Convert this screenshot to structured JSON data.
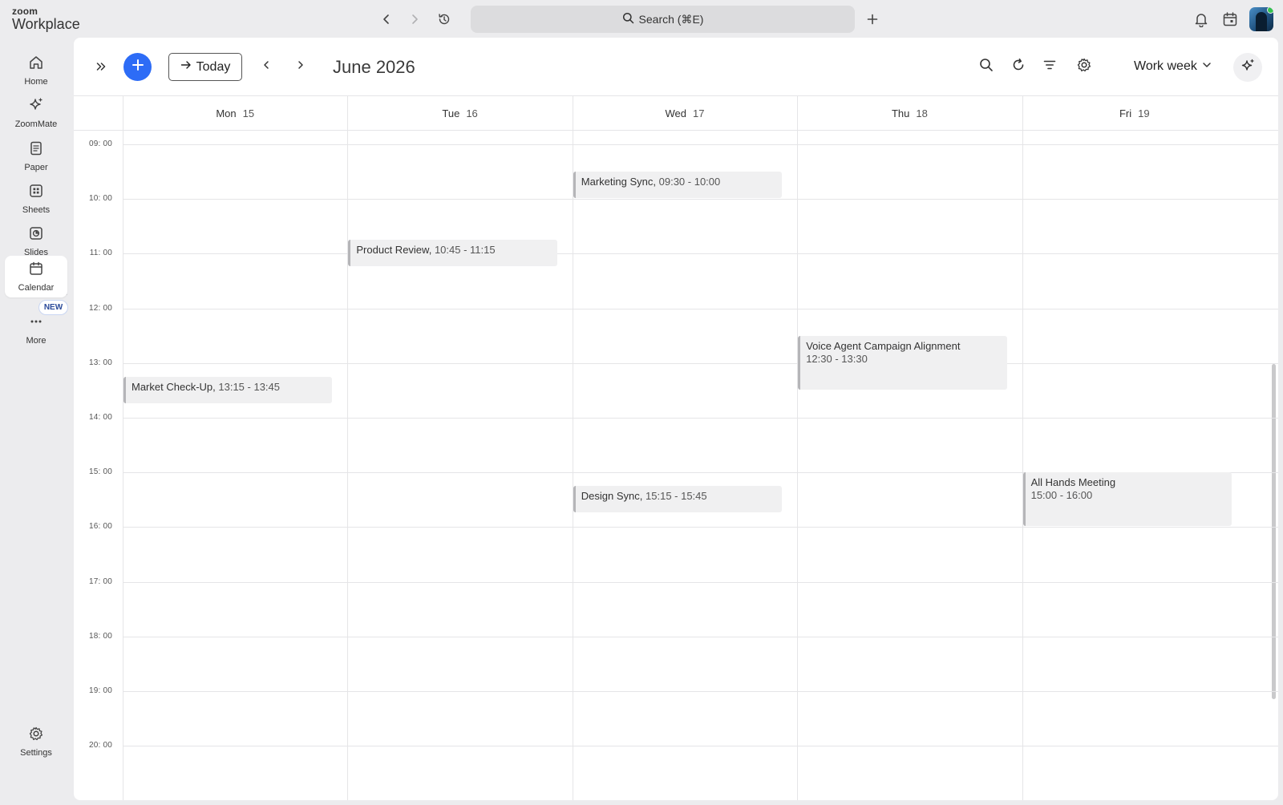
{
  "app": {
    "logo_small": "zoom",
    "logo_big": "Workplace"
  },
  "titlebar": {
    "search_label": "Search (⌘E)",
    "icons": [
      "back-icon",
      "forward-icon",
      "history-icon",
      "plus-icon",
      "bell-icon",
      "calendar-icon"
    ]
  },
  "sidebar": {
    "items": [
      {
        "label": "Home",
        "icon": "home-icon"
      },
      {
        "label": "ZoomMate",
        "icon": "sparkle-icon"
      },
      {
        "label": "Paper",
        "icon": "paper-icon"
      },
      {
        "label": "Sheets",
        "icon": "sheets-icon"
      },
      {
        "label": "Slides",
        "icon": "slides-icon"
      },
      {
        "label": "Calendar",
        "icon": "calendar-icon",
        "active": true
      },
      {
        "label": "More",
        "icon": "more-icon"
      }
    ],
    "new_badge": "NEW",
    "settings_label": "Settings"
  },
  "toolbar": {
    "today_label": "Today",
    "month_title": "June 2026",
    "view_label": "Work week"
  },
  "days": [
    {
      "name": "Mon",
      "num": "15"
    },
    {
      "name": "Tue",
      "num": "16"
    },
    {
      "name": "Wed",
      "num": "17"
    },
    {
      "name": "Thu",
      "num": "18"
    },
    {
      "name": "Fri",
      "num": "19"
    }
  ],
  "hours": [
    "09: 00",
    "10: 00",
    "11: 00",
    "12: 00",
    "13: 00",
    "14: 00",
    "15: 00",
    "16: 00",
    "17: 00",
    "18: 00",
    "19: 00",
    "20: 00"
  ],
  "events": [
    {
      "title": "Marketing Sync,",
      "time": "09:30 - 10:00",
      "day": 2,
      "start": 9.5,
      "end": 10.0,
      "inline": true
    },
    {
      "title": "Product Review,",
      "time": "10:45 - 11:15",
      "day": 1,
      "start": 10.75,
      "end": 11.25,
      "inline": true
    },
    {
      "title": "Voice Agent Campaign Alignment",
      "time": "12:30 - 13:30",
      "day": 3,
      "start": 12.5,
      "end": 13.5,
      "inline": false
    },
    {
      "title": "Market Check-Up,",
      "time": "13:15 - 13:45",
      "day": 0,
      "start": 13.25,
      "end": 13.75,
      "inline": true
    },
    {
      "title": "Design Sync,",
      "time": "15:15 - 15:45",
      "day": 2,
      "start": 15.25,
      "end": 15.75,
      "inline": true
    },
    {
      "title": "All Hands Meeting",
      "time": "15:00 - 16:00",
      "day": 4,
      "start": 15.0,
      "end": 16.0,
      "inline": false
    }
  ]
}
